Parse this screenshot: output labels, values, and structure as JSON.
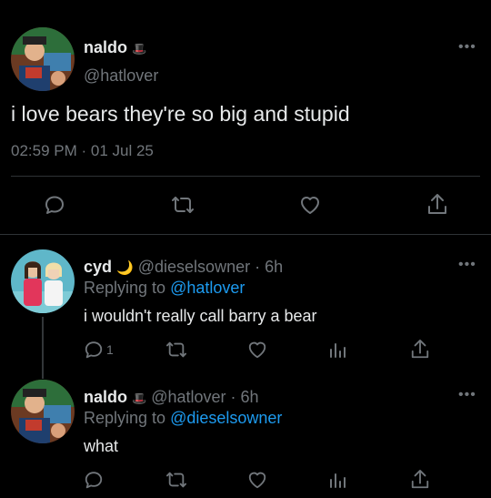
{
  "main_tweet": {
    "display_name": "naldo",
    "emoji": "🎩",
    "handle": "@hatlover",
    "text": "i love bears they're so big and stupid",
    "time": "02:59 PM · 01 Jul 25",
    "more": "•••"
  },
  "replies": [
    {
      "display_name": "cyd",
      "emoji": "🌙",
      "handle_time": "@dieselsowner · 6h",
      "replying_prefix": "Replying to",
      "replying_to": "@hatlover",
      "text": "i wouldn't really call barry a bear",
      "reply_count": "1",
      "more": "•••"
    },
    {
      "display_name": "naldo",
      "emoji": "🎩",
      "handle_time": "@hatlover · 6h",
      "replying_prefix": "Replying to",
      "replying_to": "@dieselsowner",
      "text": "what",
      "more": "•••"
    }
  ],
  "colors": {
    "background": "#000000",
    "text": "#e7e9ea",
    "muted": "#71767b",
    "link": "#1d9bf0",
    "divider": "#2f3336"
  },
  "icons": [
    "reply-icon",
    "retweet-icon",
    "like-icon",
    "analytics-icon",
    "share-icon",
    "more-icon"
  ]
}
